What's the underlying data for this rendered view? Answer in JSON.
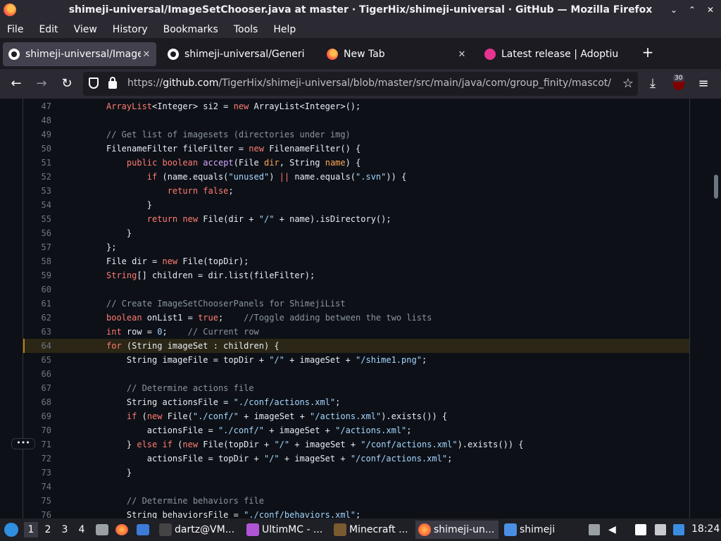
{
  "window": {
    "title": "shimeji-universal/ImageSetChooser.java at master · TigerHix/shimeji-universal · GitHub — Mozilla Firefox",
    "controls": [
      "⌄",
      "⌃",
      "✕"
    ]
  },
  "menu": [
    "File",
    "Edit",
    "View",
    "History",
    "Bookmarks",
    "Tools",
    "Help"
  ],
  "tabs": [
    {
      "label": "shimeji-universal/ImageS",
      "icon": "github-icon",
      "active": true
    },
    {
      "label": "shimeji-universal/Generi",
      "icon": "github-icon",
      "active": false
    },
    {
      "label": "New Tab",
      "icon": "firefox-icon",
      "active": false
    },
    {
      "label": "Latest release | Adoptiu",
      "icon": "adoptium-icon",
      "active": false
    }
  ],
  "tab_close": "✕",
  "new_tab": "+",
  "nav": {
    "back": "←",
    "forward": "→",
    "reload": "↻",
    "url_scheme": "https://",
    "url_host": "github.com",
    "url_path": "/TigerHix/shimeji-universal/blob/master/src/main/java/com/group_finity/mascot/",
    "bookmark_star": "☆",
    "download": "⤓",
    "extension_badge": "30",
    "menu": "≡"
  },
  "code": {
    "highlight_line": 64,
    "lines": [
      {
        "n": "47",
        "html": "        <span class='kw'>ArrayList</span>&lt;Integer&gt; si2 = <span class='kw'>new</span> ArrayList&lt;Integer&gt;();"
      },
      {
        "n": "48",
        "html": ""
      },
      {
        "n": "49",
        "html": "        <span class='cmt'>// Get list of imagesets (directories under img)</span>"
      },
      {
        "n": "50",
        "html": "        FilenameFilter fileFilter = <span class='kw'>new</span> FilenameFilter() {"
      },
      {
        "n": "51",
        "html": "            <span class='kw'>public boolean</span> <span class='fn'>accept</span>(File <span class='var'>dir</span>, String <span class='var'>name</span>) {"
      },
      {
        "n": "52",
        "html": "                <span class='kw'>if</span> (name.equals(<span class='str'>\"unused\"</span>) <span class='kw'>||</span> name.equals(<span class='str'>\".svn\"</span>)) {"
      },
      {
        "n": "53",
        "html": "                    <span class='kw'>return false</span>;"
      },
      {
        "n": "54",
        "html": "                }"
      },
      {
        "n": "55",
        "html": "                <span class='kw'>return new</span> File(dir + <span class='str'>\"/\"</span> + name).isDirectory();"
      },
      {
        "n": "56",
        "html": "            }"
      },
      {
        "n": "57",
        "html": "        };"
      },
      {
        "n": "58",
        "html": "        File dir = <span class='kw'>new</span> File(topDir);"
      },
      {
        "n": "59",
        "html": "        <span class='kw'>String</span>[] children = dir.list(fileFilter);"
      },
      {
        "n": "60",
        "html": ""
      },
      {
        "n": "61",
        "html": "        <span class='cmt'>// Create ImageSetChooserPanels for ShimejiList</span>"
      },
      {
        "n": "62",
        "html": "        <span class='kw'>boolean</span> onList1 = <span class='kw'>true</span>;    <span class='cmt'>//Toggle adding between the two lists</span>"
      },
      {
        "n": "63",
        "html": "        <span class='kw'>int</span> row = <span class='str'>0</span>;    <span class='cmt'>// Current row</span>"
      },
      {
        "n": "64",
        "html": "        <span class='kw'>for</span> (String imageSet : children) {"
      },
      {
        "n": "65",
        "html": "            String imageFile = topDir + <span class='str'>\"/\"</span> + imageSet + <span class='str'>\"/shime1.png\"</span>;"
      },
      {
        "n": "66",
        "html": ""
      },
      {
        "n": "67",
        "html": "            <span class='cmt'>// Determine actions file</span>"
      },
      {
        "n": "68",
        "html": "            String actionsFile = <span class='str'>\"./conf/actions.xml\"</span>;"
      },
      {
        "n": "69",
        "html": "            <span class='kw'>if</span> (<span class='kw'>new</span> File(<span class='str'>\"./conf/\"</span> + imageSet + <span class='str'>\"/actions.xml\"</span>).exists()) {"
      },
      {
        "n": "70",
        "html": "                actionsFile = <span class='str'>\"./conf/\"</span> + imageSet + <span class='str'>\"/actions.xml\"</span>;"
      },
      {
        "n": "71",
        "html": "            } <span class='kw'>else if</span> (<span class='kw'>new</span> File(topDir + <span class='str'>\"/\"</span> + imageSet + <span class='str'>\"/conf/actions.xml\"</span>).exists()) {"
      },
      {
        "n": "72",
        "html": "                actionsFile = topDir + <span class='str'>\"/\"</span> + imageSet + <span class='str'>\"/conf/actions.xml\"</span>;"
      },
      {
        "n": "73",
        "html": "            }"
      },
      {
        "n": "74",
        "html": ""
      },
      {
        "n": "75",
        "html": "            <span class='cmt'>// Determine behaviors file</span>"
      },
      {
        "n": "76",
        "html": "            String behaviorsFile = <span class='str'>\"./conf/behaviors.xml\"</span>;"
      }
    ]
  },
  "gutter_menu": "•••",
  "taskbar": {
    "workspaces": [
      "1",
      "2",
      "3",
      "4"
    ],
    "tasks": [
      {
        "label": "dartz@VM...",
        "icon": "terminal-icon"
      },
      {
        "label": "UltimMC - ...",
        "icon": "ultimmc-icon"
      },
      {
        "label": "Minecraft ...",
        "icon": "minecraft-icon"
      },
      {
        "label": "shimeji-un...",
        "icon": "firefox-icon"
      },
      {
        "label": "shimeji",
        "icon": "folder-icon"
      }
    ],
    "clock": "18:24"
  }
}
